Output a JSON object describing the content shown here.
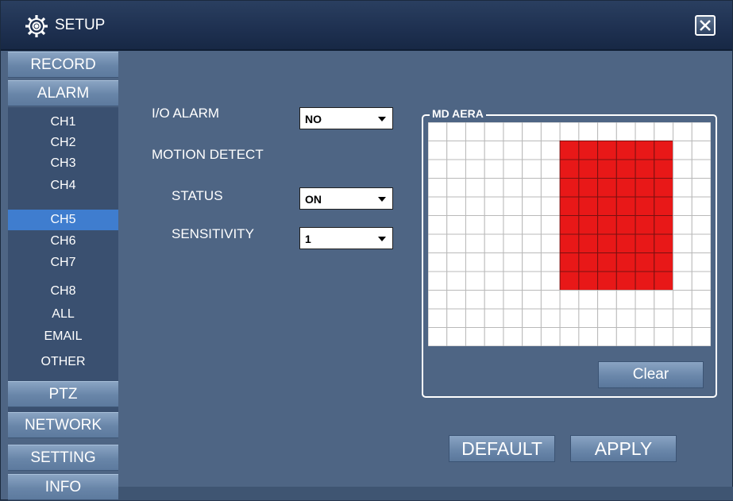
{
  "window": {
    "title": "SETUP",
    "icon": "gear-icon",
    "close_icon": "close-icon"
  },
  "sidebar": {
    "top_items": [
      {
        "label": "RECORD"
      },
      {
        "label": "ALARM"
      }
    ],
    "sub_items": [
      {
        "label": "CH1"
      },
      {
        "label": "CH2"
      },
      {
        "label": "CH3"
      },
      {
        "label": "CH4"
      },
      {
        "label": "CH5",
        "selected": true
      },
      {
        "label": "CH6"
      },
      {
        "label": "CH7"
      },
      {
        "label": "CH8"
      },
      {
        "label": "ALL"
      },
      {
        "label": "EMAIL"
      },
      {
        "label": "OTHER"
      }
    ],
    "bottom_items": [
      {
        "label": "PTZ"
      },
      {
        "label": "NETWORK"
      },
      {
        "label": "SETTING"
      },
      {
        "label": "INFO"
      }
    ]
  },
  "form": {
    "io_alarm_label": "I/O ALARM",
    "io_alarm_value": "NO",
    "motion_detect_label": "MOTION DETECT",
    "status_label": "STATUS",
    "status_value": "ON",
    "sensitivity_label": "SENSITIVITY",
    "sensitivity_value": "1"
  },
  "md_area": {
    "title": "MD AERA",
    "columns": 15,
    "rows": 12,
    "selected_region": {
      "col_start": 7,
      "col_end": 12,
      "row_start": 1,
      "row_end": 8
    },
    "selected_color": "#e81818",
    "clear_label": "Clear"
  },
  "buttons": {
    "default_label": "DEFAULT",
    "apply_label": "APPLY"
  }
}
